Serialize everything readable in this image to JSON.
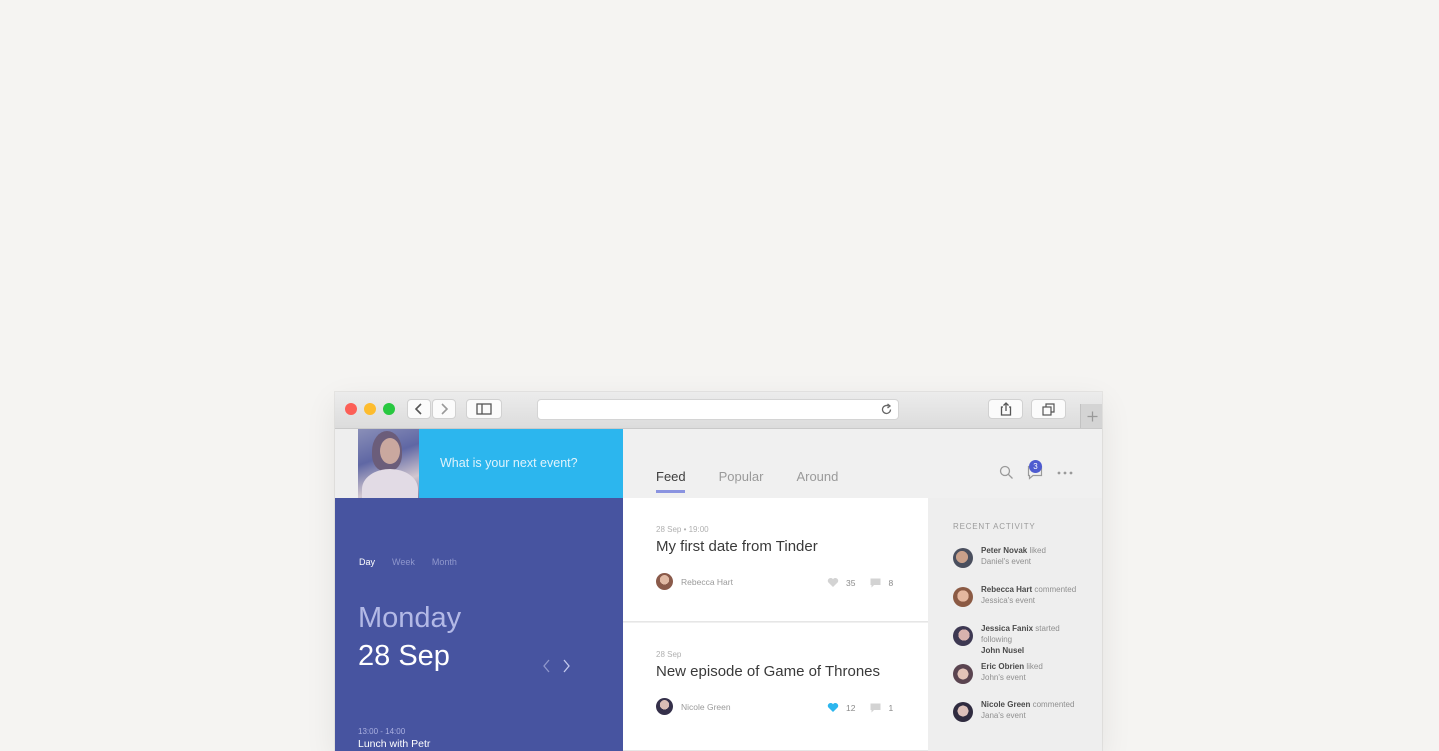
{
  "browser": {
    "back_icon": "chevron-left-icon",
    "forward_icon": "chevron-right-icon",
    "sidebar_icon": "sidebar-icon",
    "reload_icon": "reload-icon",
    "share_icon": "share-icon",
    "tabs_icon": "tabs-overview-icon",
    "new_tab_icon": "plus-icon"
  },
  "composer": {
    "placeholder": "What is your next event?"
  },
  "calendar": {
    "ranges": [
      "Day",
      "Week",
      "Month"
    ],
    "active_range": "Day",
    "day_name": "Monday",
    "date": "28 Sep",
    "event_time": "13:00 - 14:00",
    "event_title": "Lunch with Petr"
  },
  "tabs": [
    {
      "label": "Feed",
      "active": true
    },
    {
      "label": "Popular",
      "active": false
    },
    {
      "label": "Around",
      "active": false
    }
  ],
  "header": {
    "notification_count": "3"
  },
  "feed": [
    {
      "meta": "28 Sep • 19:00",
      "title": "My first date from Tinder",
      "author": "Rebecca Hart",
      "likes": "35",
      "comments": "8",
      "liked": false
    },
    {
      "meta": "28 Sep",
      "title": "New episode of Game of Thrones",
      "author": "Nicole Green",
      "likes": "12",
      "comments": "1",
      "liked": true
    }
  ],
  "activity": {
    "heading": "RECENT ACTIVITY",
    "items": [
      {
        "name": "Peter Novak",
        "action": "liked",
        "object": "Daniel's event",
        "object_bold": false
      },
      {
        "name": "Rebecca Hart",
        "action": "commented",
        "object": "Jessica's event",
        "object_bold": false
      },
      {
        "name": "Jessica Fanix",
        "action": "started following",
        "object": "John Nusel",
        "object_bold": true
      },
      {
        "name": "Eric Obrien",
        "action": "liked",
        "object": "John's event",
        "object_bold": false
      },
      {
        "name": "Nicole Green",
        "action": "commented",
        "object": "Jana's event",
        "object_bold": false
      }
    ]
  },
  "colors": {
    "sidebar": "#4754a0",
    "composer": "#2cb6ee",
    "accent": "#8a93e0",
    "like_active": "#2cb6ee",
    "badge": "#4e5bd0"
  }
}
